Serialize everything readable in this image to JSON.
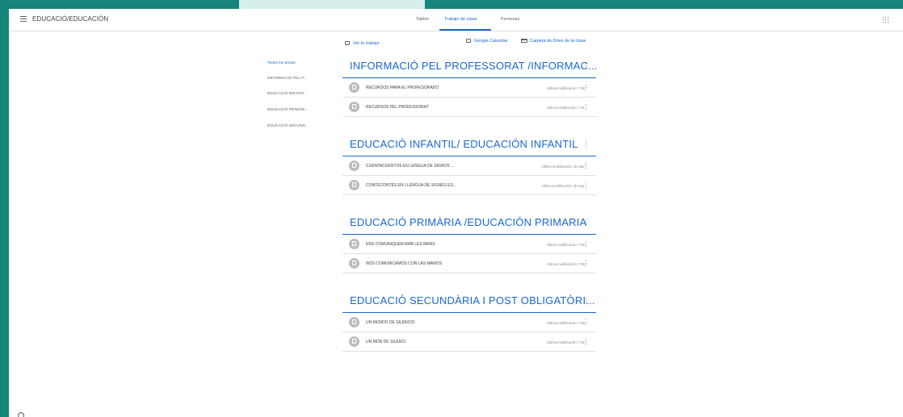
{
  "header": {
    "class_title": "EDUCACIÓ/EDUCACIÓN",
    "tabs": [
      {
        "label": "Tablón"
      },
      {
        "label": "Trabajo de clase"
      },
      {
        "label": "Personas"
      }
    ]
  },
  "actions": {
    "view_work": "Ver tu trabajo",
    "calendar": "Google Calendar",
    "drive": "Carpeta de Drive de la clase"
  },
  "nav": {
    "items": [
      {
        "label": "Todos los temas"
      },
      {
        "label": "INFORMACIÓ PEL P..."
      },
      {
        "label": "EDUCACIÓ INFANTI..."
      },
      {
        "label": "EDUCACIÓ PRIMÀRI..."
      },
      {
        "label": "EDUCACIÓ SECUND..."
      }
    ]
  },
  "topics": [
    {
      "title": "INFORMACIÓ PEL PROFESSORAT /INFORMAC...",
      "items": [
        {
          "title": "RECURSOS PARA EL PROFESORADO",
          "meta": "Última modificación: 7:50"
        },
        {
          "title": "RECURSOS PEL PROFESSORAT",
          "meta": "Última modificación: 7:51"
        }
      ]
    },
    {
      "title": "EDUCACIÓ INFANTIL/ EDUCACIÓN INFANTIL",
      "items": [
        {
          "title": "CUENTACUENTOS EN LENGUA DE SIGNOS ...",
          "meta": "Última modificación: 25 may."
        },
        {
          "title": "CONTECONTES EN LLENGUA DE SIGNES ES...",
          "meta": "Última modificación: 25 may."
        }
      ]
    },
    {
      "title": "EDUCACIÓ PRIMÀRIA /EDUCACIÓN PRIMARIA",
      "items": [
        {
          "title": "ENS COMUNIQUEM AMB LES MANS",
          "meta": "Última modificación: 7:45"
        },
        {
          "title": "NOS COMUNICAMOS CON LAS MANOS",
          "meta": "Última modificación: 7:50"
        }
      ]
    },
    {
      "title": "EDUCACIÓ SECUNDÀRIA I POST OBLIGATÒRI...",
      "items": [
        {
          "title": "UN MUNDO DE SILENCIO",
          "meta": "Última modificación: 7:50"
        },
        {
          "title": "UN MÓN DE SILENCI",
          "meta": "Última modificación: 7:51"
        }
      ]
    }
  ],
  "colors": {
    "frame": "#16857a",
    "accent": "#1967d2"
  }
}
